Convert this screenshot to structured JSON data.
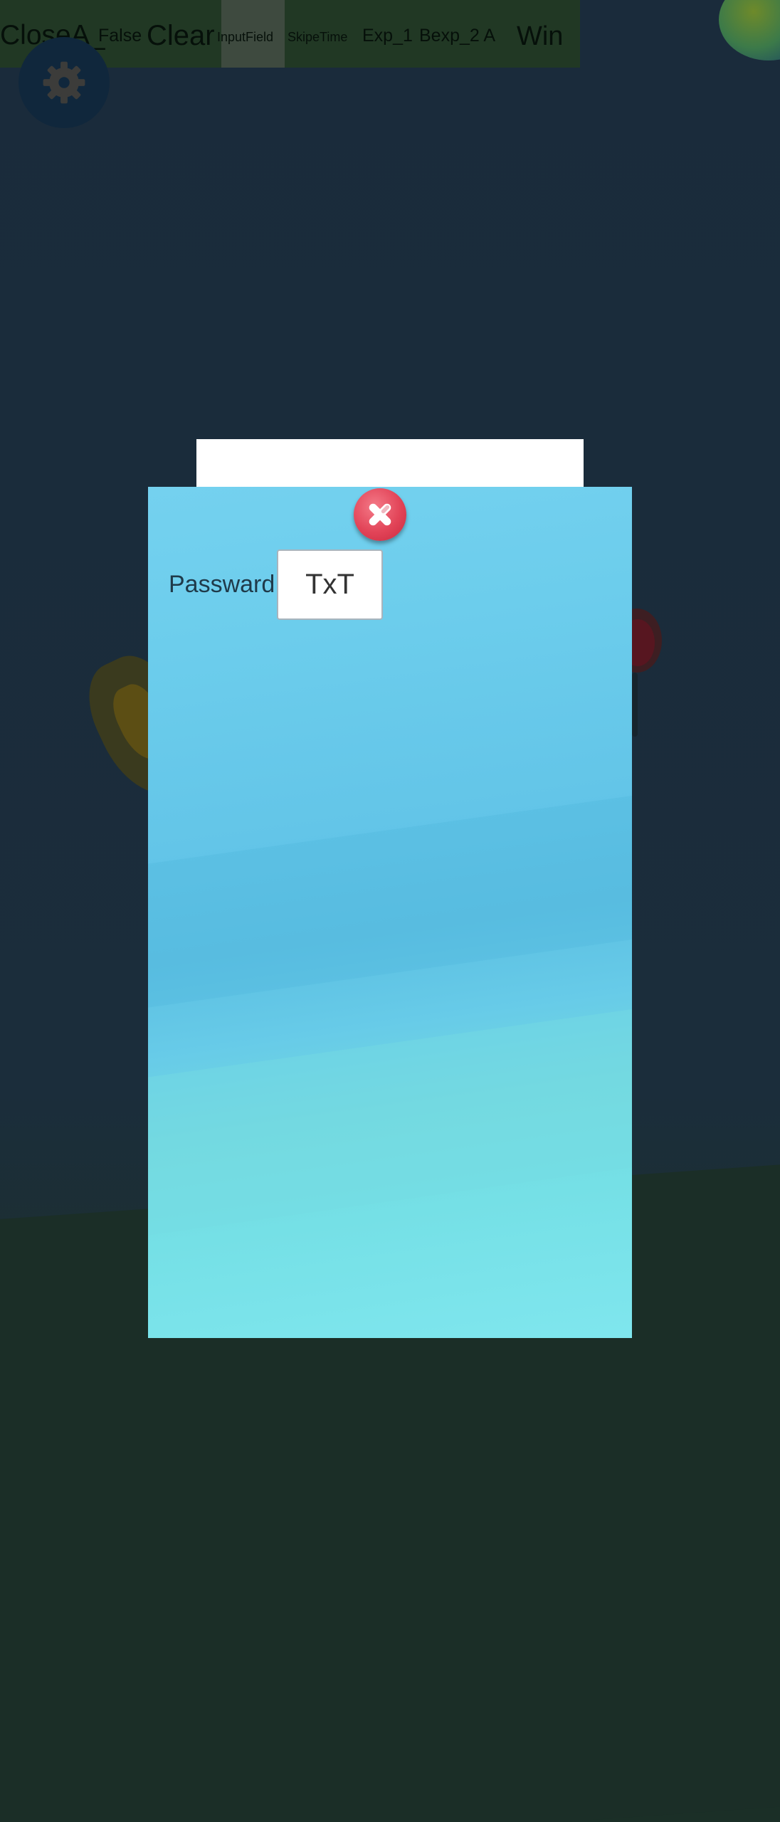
{
  "debug_bar": {
    "close_label": "CloseA_",
    "false_label": "False",
    "clear_label": "Clear",
    "inputfield_label": "InputField",
    "skiptime_label": "SkipeTime",
    "exp1_label": "Exp_1",
    "exp2_label": "Bexp_2 A",
    "win_label": "Win"
  },
  "icons": {
    "settings": "gear-icon",
    "globe": "globe-icon",
    "close": "close-icon"
  },
  "modal": {
    "password_label": "Passward",
    "password_value": "TxT"
  },
  "colors": {
    "modal_top": "#74d1ef",
    "modal_bottom": "#7fe6ee",
    "close_red": "#e24458",
    "debug_bar": "#213824",
    "background": "#1a2b3b"
  }
}
